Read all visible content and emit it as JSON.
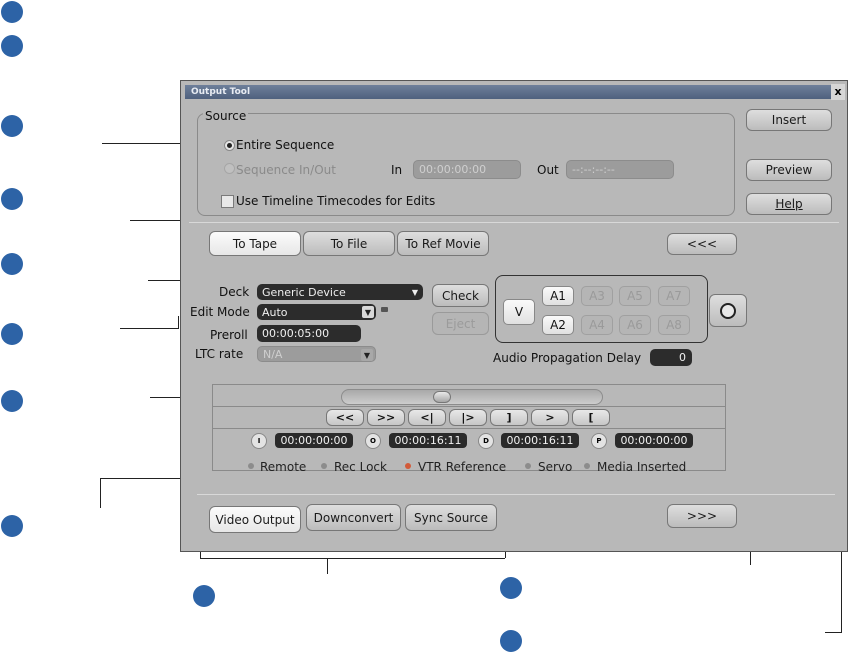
{
  "window": {
    "title": "Output Tool",
    "close": "x"
  },
  "source": {
    "label": "Source",
    "options": [
      "Entire Sequence",
      "Sequence In/Out"
    ],
    "selected": "Entire Sequence",
    "in_label": "In",
    "in_value": "00:00:00:00",
    "out_label": "Out",
    "out_value": "--:--:--:--",
    "use_timeline_label": "Use Timeline Timecodes for Edits"
  },
  "side_buttons": {
    "insert": "Insert",
    "preview": "Preview",
    "help": "Help"
  },
  "modes": {
    "to_tape": "To Tape",
    "to_file": "To File",
    "to_ref_movie": "To Ref Movie",
    "collapse": "<<<"
  },
  "deck": {
    "deck_label": "Deck",
    "deck_value": "Generic Device",
    "edit_mode_label": "Edit Mode",
    "edit_mode_value": "Auto",
    "preroll_label": "Preroll",
    "preroll_value": "00:00:05:00",
    "ltc_label": "LTC rate",
    "ltc_value": "N/A",
    "check": "Check",
    "eject": "Eject"
  },
  "channels": {
    "video": "V",
    "audio_enabled": [
      "A1",
      "A2"
    ],
    "audio_disabled": [
      "A3",
      "A5",
      "A7",
      "A4",
      "A6",
      "A8"
    ]
  },
  "audio_delay": {
    "label": "Audio Propagation Delay",
    "value": "0"
  },
  "transport": {
    "buttons": [
      "<<",
      ">>",
      "<|",
      "|>",
      "]",
      ">",
      "["
    ]
  },
  "timecodes": [
    {
      "badge": "I",
      "value": "00:00:00:00"
    },
    {
      "badge": "O",
      "value": "00:00:16:11"
    },
    {
      "badge": "D",
      "value": "00:00:16:11"
    },
    {
      "badge": "P",
      "value": "00:00:00:00"
    }
  ],
  "status": [
    {
      "label": "Remote",
      "color": "#8c8c8c"
    },
    {
      "label": "Rec Lock",
      "color": "#8c8c8c"
    },
    {
      "label": "VTR Reference",
      "color": "#d25b3a"
    },
    {
      "label": "Servo",
      "color": "#8c8c8c"
    },
    {
      "label": "Media Inserted",
      "color": "#8c8c8c"
    }
  ],
  "bottom_tabs": {
    "video_output": "Video Output",
    "downconvert": "Downconvert",
    "sync_source": "Sync Source",
    "expand": ">>>"
  },
  "colors": {
    "callout": "#2d63a6",
    "window_bg": "#b8b8b8",
    "title_bar": "#5a6b88"
  }
}
